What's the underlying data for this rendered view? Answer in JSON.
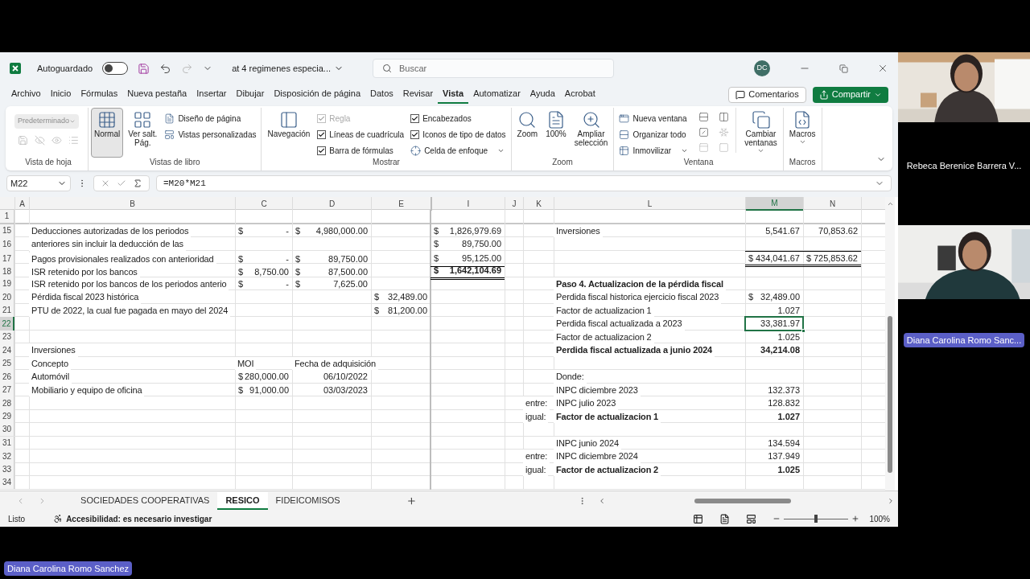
{
  "title_bar": {
    "autosave_label": "Autoguardado",
    "autosave_on": false,
    "filename": "at 4 regimenes especia...",
    "search_placeholder": "Buscar",
    "user_initials": "DC"
  },
  "menu_tabs": [
    {
      "label": "Archivo",
      "selected": false
    },
    {
      "label": "Inicio",
      "selected": false
    },
    {
      "label": "Fórmulas",
      "selected": false
    },
    {
      "label": "Nueva pestaña",
      "selected": false
    },
    {
      "label": "Insertar",
      "selected": false
    },
    {
      "label": "Dibujar",
      "selected": false
    },
    {
      "label": "Disposición de página",
      "selected": false
    },
    {
      "label": "Datos",
      "selected": false
    },
    {
      "label": "Revisar",
      "selected": false
    },
    {
      "label": "Vista",
      "selected": true
    },
    {
      "label": "Automatizar",
      "selected": false
    },
    {
      "label": "Ayuda",
      "selected": false
    },
    {
      "label": "Acrobat",
      "selected": false
    }
  ],
  "comments_button": "Comentarios",
  "share_button": "Compartir",
  "ribbon": {
    "groups": [
      {
        "kind": "sheet_view",
        "label": "Vista de hoja",
        "items": [
          {
            "kind": "dropdown",
            "label": "Predeterminado",
            "disabled": true
          }
        ]
      },
      {
        "kind": "workbook_views",
        "label": "Vistas de libro",
        "items": [
          {
            "kind": "large",
            "label": "Normal",
            "selected": true
          },
          {
            "kind": "large",
            "label": "Ver salt.\nPág.",
            "selected": false
          },
          {
            "kind": "small",
            "label": "Diseño de página"
          },
          {
            "kind": "small",
            "label": "Vistas personalizadas"
          }
        ]
      },
      {
        "kind": "show",
        "label": "Mostrar",
        "items": [
          {
            "kind": "large",
            "label": "Navegación",
            "selected": false
          },
          {
            "kind": "check",
            "label": "Regla",
            "checked": true,
            "disabled": true
          },
          {
            "kind": "check",
            "label": "Líneas de cuadrícula",
            "checked": true,
            "disabled": false
          },
          {
            "kind": "check",
            "label": "Barra de fórmulas",
            "checked": true,
            "disabled": false
          },
          {
            "kind": "check",
            "label": "Encabezados",
            "checked": true,
            "disabled": false
          },
          {
            "kind": "check",
            "label": "Iconos de tipo de datos",
            "checked": true,
            "disabled": false
          },
          {
            "kind": "small",
            "label": "Celda de enfoque",
            "dropdown": true
          }
        ]
      },
      {
        "kind": "zoom",
        "label": "Zoom",
        "items": [
          {
            "kind": "large",
            "label": "Zoom",
            "selected": false
          },
          {
            "kind": "large",
            "label": "100%",
            "selected": false
          },
          {
            "kind": "large",
            "label": "Ampliar\nselección",
            "selected": false
          }
        ]
      },
      {
        "kind": "window",
        "label": "Ventana",
        "items": [
          {
            "kind": "small",
            "label": "Nueva ventana"
          },
          {
            "kind": "small",
            "label": "Organizar todo"
          },
          {
            "kind": "small",
            "label": "Inmovilizar",
            "dropdown": true
          },
          {
            "kind": "large",
            "label": "Cambiar\nventanas",
            "selected": false,
            "dropdown": true
          }
        ]
      },
      {
        "kind": "macros",
        "label": "Macros",
        "items": [
          {
            "kind": "large",
            "label": "Macros",
            "selected": false,
            "dropdown": true
          }
        ]
      }
    ]
  },
  "formula_bar": {
    "name_box": "M22",
    "formula": "=M20*M21"
  },
  "sheet": {
    "columns": [
      {
        "label": "A",
        "selected": false
      },
      {
        "label": "B",
        "selected": false
      },
      {
        "label": "C",
        "selected": false
      },
      {
        "label": "D",
        "selected": false
      },
      {
        "label": "E",
        "selected": false
      },
      {
        "label": "I",
        "selected": false
      },
      {
        "label": "J",
        "selected": false
      },
      {
        "label": "K",
        "selected": false
      },
      {
        "label": "L",
        "selected": false
      },
      {
        "label": "M",
        "selected": true
      },
      {
        "label": "N",
        "selected": false
      }
    ],
    "rows": [
      {
        "number": "1",
        "selected": false,
        "cells": {}
      },
      {
        "number": "15",
        "selected": false,
        "cells": {
          "B": {
            "kind": "text",
            "text": "Deducciones autorizadas de los periodos",
            "selected": false
          },
          "C": {
            "kind": "money",
            "sym": "$",
            "num": "-",
            "selected": false
          },
          "D": {
            "kind": "money",
            "sym": "$",
            "num": "4,980,000.00",
            "selected": false
          },
          "I": {
            "kind": "money",
            "sym": "$",
            "num": "1,826,979.69",
            "selected": false
          },
          "L": {
            "kind": "text",
            "text": "Inversiones",
            "selected": false
          },
          "M": {
            "kind": "number",
            "text": "5,541.67",
            "selected": false
          },
          "N": {
            "kind": "number",
            "text": "70,853.62",
            "selected": false
          }
        }
      },
      {
        "number": "16",
        "selected": false,
        "cells": {
          "B": {
            "kind": "text",
            "text": "anteriores sin incluir la deducción de las",
            "selected": false
          },
          "I": {
            "kind": "money",
            "sym": "$",
            "num": "89,750.00",
            "selected": false
          }
        }
      },
      {
        "number": "17",
        "selected": false,
        "cells": {
          "B": {
            "kind": "text",
            "text": "Pagos provisionales realizados con anterioridad",
            "selected": false
          },
          "C": {
            "kind": "money",
            "sym": "$",
            "num": "-",
            "selected": false
          },
          "D": {
            "kind": "money",
            "sym": "$",
            "num": "89,750.00",
            "selected": false
          },
          "I": {
            "kind": "money",
            "sym": "$",
            "num": "95,125.00",
            "selected": false,
            "rule_below": true
          },
          "M": {
            "kind": "money",
            "sym": "$",
            "num": "434,041.67",
            "selected": false,
            "rule_above": true,
            "double_rule_below": true
          },
          "N": {
            "kind": "money",
            "sym": "$",
            "num": "725,853.62",
            "selected": false,
            "rule_above": true,
            "double_rule_below": true
          }
        }
      },
      {
        "number": "18",
        "selected": false,
        "cells": {
          "B": {
            "kind": "text",
            "text": "ISR retenido por los bancos",
            "selected": false
          },
          "C": {
            "kind": "money",
            "sym": "$",
            "num": "8,750.00",
            "selected": false
          },
          "D": {
            "kind": "money",
            "sym": "$",
            "num": "87,500.00",
            "selected": false
          },
          "I": {
            "kind": "money",
            "sym": "$",
            "num": "1,642,104.69",
            "selected": false,
            "bold": true,
            "double_rule_below": true
          }
        }
      },
      {
        "number": "19",
        "selected": false,
        "cells": {
          "B": {
            "kind": "text",
            "text": "ISR retenido por los bancos de los periodos anterio",
            "selected": false
          },
          "C": {
            "kind": "money",
            "sym": "$",
            "num": "-",
            "selected": false
          },
          "D": {
            "kind": "money",
            "sym": "$",
            "num": "7,625.00",
            "selected": false
          },
          "L": {
            "kind": "text",
            "text": "Paso 4. Actualizacion de la pérdida fiscal",
            "selected": false,
            "bold": true
          }
        }
      },
      {
        "number": "20",
        "selected": false,
        "cells": {
          "B": {
            "kind": "text",
            "text": "Pérdida fiscal 2023 histórica",
            "selected": false
          },
          "E": {
            "kind": "money",
            "sym": "$",
            "num": "32,489.00",
            "selected": false
          },
          "L": {
            "kind": "text",
            "text": "Perdida fiscal historica ejercicio fiscal 2023",
            "selected": false
          },
          "M": {
            "kind": "money",
            "sym": "$",
            "num": "32,489.00",
            "selected": false
          }
        }
      },
      {
        "number": "21",
        "selected": false,
        "cells": {
          "B": {
            "kind": "text",
            "text": "PTU de 2022, la cual fue pagada en mayo del 2024",
            "selected": false
          },
          "E": {
            "kind": "money",
            "sym": "$",
            "num": "81,200.00",
            "selected": false
          },
          "L": {
            "kind": "text",
            "text": "Factor de actualizacion 1",
            "selected": false
          },
          "M": {
            "kind": "number",
            "text": "1.027",
            "selected": false
          }
        }
      },
      {
        "number": "22",
        "selected": true,
        "cells": {
          "L": {
            "kind": "text",
            "text": "Perdida fiscal actualizada a 2023",
            "selected": false
          },
          "M": {
            "kind": "number",
            "text": "33,381.97",
            "selected": true
          }
        }
      },
      {
        "number": "23",
        "selected": false,
        "cells": {
          "L": {
            "kind": "text",
            "text": "Factor de actualizacion 2",
            "selected": false
          },
          "M": {
            "kind": "number",
            "text": "1.025",
            "selected": false
          }
        }
      },
      {
        "number": "24",
        "selected": false,
        "cells": {
          "B": {
            "kind": "text",
            "text": "Inversiones",
            "selected": false
          },
          "L": {
            "kind": "text",
            "text": "Perdida fiscal actualizada a junio 2024",
            "selected": false,
            "bold": true
          },
          "M": {
            "kind": "number",
            "text": "34,214.08",
            "selected": false,
            "bold": true
          }
        }
      },
      {
        "number": "25",
        "selected": false,
        "cells": {
          "B": {
            "kind": "text",
            "text": "Concepto",
            "selected": false
          },
          "C": {
            "kind": "text",
            "text": "MOI",
            "selected": false
          },
          "D": {
            "kind": "text",
            "text": "Fecha de adquisición",
            "selected": false
          }
        }
      },
      {
        "number": "26",
        "selected": false,
        "cells": {
          "B": {
            "kind": "text",
            "text": "Automóvil",
            "selected": false
          },
          "C": {
            "kind": "money",
            "sym": "$",
            "num": "280,000.00",
            "selected": false
          },
          "D": {
            "kind": "number",
            "text": "06/10/2022",
            "selected": false
          },
          "L": {
            "kind": "text",
            "text": "Donde:",
            "selected": false
          }
        }
      },
      {
        "number": "27",
        "selected": false,
        "cells": {
          "B": {
            "kind": "text",
            "text": "Mobiliario y equipo de oficina",
            "selected": false
          },
          "C": {
            "kind": "money",
            "sym": "$",
            "num": "91,000.00",
            "selected": false
          },
          "D": {
            "kind": "number",
            "text": "03/03/2023",
            "selected": false
          },
          "L": {
            "kind": "text",
            "text": "INPC diciembre 2023",
            "selected": false
          },
          "M": {
            "kind": "number",
            "text": "132.373",
            "selected": false
          }
        }
      },
      {
        "number": "28",
        "selected": false,
        "cells": {
          "K": {
            "kind": "text",
            "text": "entre:",
            "selected": false
          },
          "L": {
            "kind": "text",
            "text": "INPC julio 2023",
            "selected": false
          },
          "M": {
            "kind": "number",
            "text": "128.832",
            "selected": false
          }
        }
      },
      {
        "number": "29",
        "selected": false,
        "cells": {
          "K": {
            "kind": "text",
            "text": "igual:",
            "selected": false
          },
          "L": {
            "kind": "text",
            "text": "Factor de actualizacion 1",
            "selected": false,
            "bold": true
          },
          "M": {
            "kind": "number",
            "text": "1.027",
            "selected": false,
            "bold": true
          }
        }
      },
      {
        "number": "30",
        "selected": false,
        "cells": {}
      },
      {
        "number": "31",
        "selected": false,
        "cells": {
          "L": {
            "kind": "text",
            "text": "INPC junio 2024",
            "selected": false
          },
          "M": {
            "kind": "number",
            "text": "134.594",
            "selected": false
          }
        }
      },
      {
        "number": "32",
        "selected": false,
        "cells": {
          "K": {
            "kind": "text",
            "text": "entre:",
            "selected": false
          },
          "L": {
            "kind": "text",
            "text": "INPC diciembre 2024",
            "selected": false
          },
          "M": {
            "kind": "number",
            "text": "137.949",
            "selected": false
          }
        }
      },
      {
        "number": "33",
        "selected": false,
        "cells": {
          "K": {
            "kind": "text",
            "text": "igual:",
            "selected": false
          },
          "L": {
            "kind": "text",
            "text": "Factor de actualizacion 2",
            "selected": false,
            "bold": true
          },
          "M": {
            "kind": "number",
            "text": "1.025",
            "selected": false,
            "bold": true
          }
        }
      },
      {
        "number": "34",
        "selected": false,
        "cells": {}
      }
    ]
  },
  "sheet_tabs": [
    {
      "label": "SOCIEDADES COOPERATIVAS",
      "selected": false
    },
    {
      "label": "RESICO",
      "selected": true
    },
    {
      "label": "FIDEICOMISOS",
      "selected": false
    }
  ],
  "status_bar": {
    "status": "Listo",
    "accessibility": "Accesibilidad: es necesario investigar",
    "zoom": "100%",
    "zoom_slider": {
      "level": 0.5
    }
  },
  "video_call": {
    "tiles": [
      {
        "kind": "camera"
      },
      {
        "kind": "label",
        "name": "Rebeca Berenice Barrera V..."
      },
      {
        "kind": "camera"
      },
      {
        "kind": "badge",
        "name": "Diana Carolina Romo Sanc..."
      }
    ],
    "presenter_name": "Diana Carolina Romo Sanchez"
  }
}
